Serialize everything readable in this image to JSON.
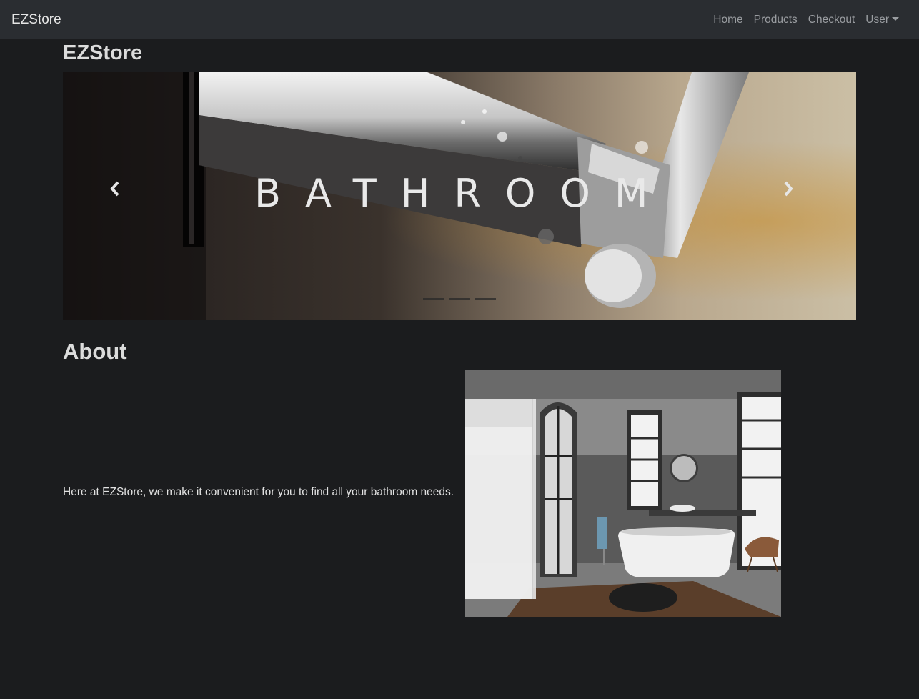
{
  "navbar": {
    "brand": "EZStore",
    "links": {
      "home": "Home",
      "products": "Products",
      "checkout": "Checkout",
      "user": "User"
    }
  },
  "page": {
    "title": "EZStore"
  },
  "carousel": {
    "slide_text": "BATHROOM",
    "slide_count": 3,
    "active_slide": 1,
    "prev_icon": "chevron-left-icon",
    "next_icon": "chevron-right-icon"
  },
  "about": {
    "heading": "About",
    "text": "Here at EZStore, we make it convenient for you to find all your bathroom needs.",
    "image_subject": "bathroom-interior"
  },
  "colors": {
    "page_background": "#1b1c1e",
    "navbar_background": "#2a2d31",
    "nav_link": "#9a9da1",
    "heading": "#dcdcdc"
  }
}
